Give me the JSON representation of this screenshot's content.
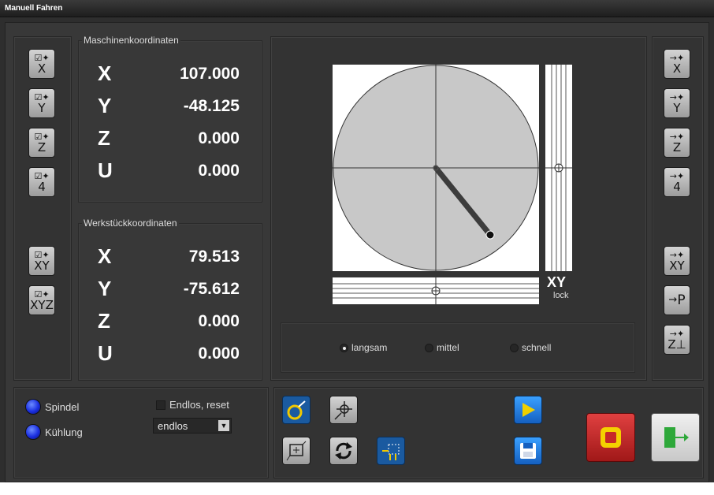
{
  "window": {
    "title": "Manuell Fahren"
  },
  "left_buttons": [
    {
      "id": "x",
      "label": "X"
    },
    {
      "id": "y",
      "label": "Y"
    },
    {
      "id": "z",
      "label": "Z"
    },
    {
      "id": "4",
      "label": "4"
    },
    {
      "id": "xy",
      "label": "XY"
    },
    {
      "id": "xyz",
      "label": "XYZ"
    }
  ],
  "machine": {
    "title": "Maschinenkoordinaten",
    "rows": [
      {
        "axis": "X",
        "value": "107.000"
      },
      {
        "axis": "Y",
        "value": "-48.125"
      },
      {
        "axis": "Z",
        "value": "0.000"
      },
      {
        "axis": "U",
        "value": "0.000"
      }
    ]
  },
  "workpiece": {
    "title": "Werkstückkoordinaten",
    "rows": [
      {
        "axis": "X",
        "value": "79.513"
      },
      {
        "axis": "Y",
        "value": "-75.612"
      },
      {
        "axis": "Z",
        "value": "0.000"
      },
      {
        "axis": "U",
        "value": "0.000"
      }
    ]
  },
  "joystick": {
    "xy_label": "XY",
    "lock_label": "lock"
  },
  "speed": {
    "options": [
      "langsam",
      "mittel",
      "schnell"
    ],
    "selected": "langsam"
  },
  "right_buttons": [
    {
      "id": "x",
      "label": "X"
    },
    {
      "id": "y",
      "label": "Y"
    },
    {
      "id": "z",
      "label": "Z"
    },
    {
      "id": "4",
      "label": "4"
    },
    {
      "id": "xy",
      "label": "XY"
    },
    {
      "id": "p",
      "label": "P"
    },
    {
      "id": "z-down",
      "label": "Z"
    }
  ],
  "outputs": {
    "spindle": "Spindel",
    "cooling": "Kühlung",
    "endless_checkbox": "Endlos, reset",
    "endless_select": "endlos"
  },
  "colors": {
    "led_blue": "#1a2ee0",
    "play_blue": "#1e88e5",
    "stop_red": "#c62828",
    "stop_yellow": "#f4d000",
    "exit_green": "#2ea83a",
    "tool_blue": "#1a5aa0"
  }
}
